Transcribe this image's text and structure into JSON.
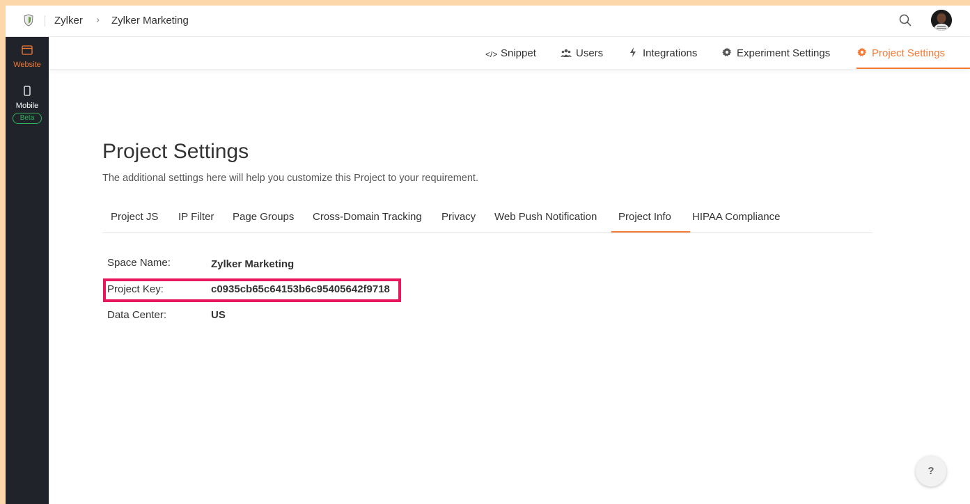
{
  "breadcrumb": {
    "org": "Zylker",
    "separator": "›",
    "project": "Zylker Marketing"
  },
  "rail": {
    "website": {
      "label": "Website",
      "icon": "browser-window-icon"
    },
    "mobile": {
      "label": "Mobile",
      "icon": "mobile-phone-icon",
      "badge": "Beta"
    }
  },
  "subnav": [
    {
      "label": "Snippet",
      "icon": "code-icon"
    },
    {
      "label": "Users",
      "icon": "users-icon"
    },
    {
      "label": "Integrations",
      "icon": "bolt-icon"
    },
    {
      "label": "Experiment Settings",
      "icon": "gear-icon"
    },
    {
      "label": "Project Settings",
      "icon": "gear-icon",
      "active": true
    }
  ],
  "page": {
    "title": "Project Settings",
    "description": "The additional settings here will help you customize this Project to your requirement."
  },
  "tabs": [
    "Project JS",
    "IP Filter",
    "Page Groups",
    "Cross-Domain Tracking",
    "Privacy",
    "Web Push Notification",
    "Project Info",
    "HIPAA Compliance"
  ],
  "active_tab": "Project Info",
  "info": [
    {
      "label": "Space Name:",
      "value": "Zylker Marketing"
    },
    {
      "label": "Project Key:",
      "value": "c0935cb65c64153b6c95405642f9718"
    },
    {
      "label": "Data Center:",
      "value": "US"
    }
  ],
  "help": {
    "label": "?"
  },
  "colors": {
    "accent": "#f47a36",
    "rail": "#20232a",
    "highlight": "#e8175d",
    "beta": "#33b35a",
    "frame": "#fcd7aa"
  }
}
